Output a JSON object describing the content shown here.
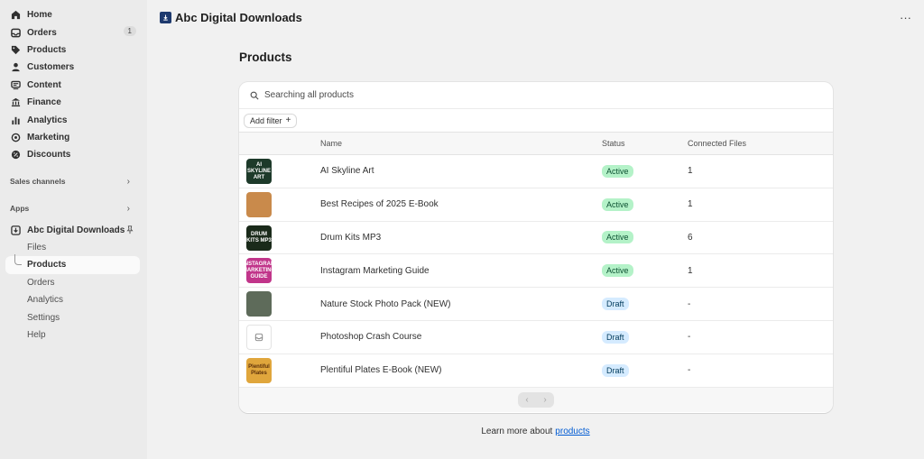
{
  "sidebar": {
    "nav": [
      {
        "label": "Home",
        "icon": "home-icon"
      },
      {
        "label": "Orders",
        "icon": "orders-icon",
        "count": "1"
      },
      {
        "label": "Products",
        "icon": "tag-icon"
      },
      {
        "label": "Customers",
        "icon": "person-icon"
      },
      {
        "label": "Content",
        "icon": "content-icon"
      },
      {
        "label": "Finance",
        "icon": "bank-icon"
      },
      {
        "label": "Analytics",
        "icon": "bar-chart-icon"
      },
      {
        "label": "Marketing",
        "icon": "target-icon"
      },
      {
        "label": "Discounts",
        "icon": "discount-icon"
      }
    ],
    "sales_channels_label": "Sales channels",
    "apps_label": "Apps",
    "app_name": "Abc Digital Downloads",
    "app_subitems": [
      "Files",
      "Products",
      "Orders",
      "Analytics",
      "Settings",
      "Help"
    ],
    "active_subitem": "Products"
  },
  "topbar": {
    "title": "Abc Digital Downloads",
    "more_label": "···"
  },
  "main": {
    "page_title": "Products",
    "search_text": "Searching all products",
    "add_filter_label": "Add filter",
    "add_filter_plus": "+",
    "columns": {
      "name": "Name",
      "status": "Status",
      "files": "Connected Files"
    },
    "rows": [
      {
        "name": "AI Skyline Art",
        "status": "Active",
        "files": "1",
        "thumb_text": "AI SKYLINE ART",
        "thumb_color": "#1d3a2a"
      },
      {
        "name": "Best Recipes of 2025 E-Book",
        "status": "Active",
        "files": "1",
        "thumb_text": "",
        "thumb_color": "#c98a4b"
      },
      {
        "name": "Drum Kits MP3",
        "status": "Active",
        "files": "6",
        "thumb_text": "DRUM KITS MP3",
        "thumb_color": "#1a2a1a"
      },
      {
        "name": "Instagram Marketing Guide",
        "status": "Active",
        "files": "1",
        "thumb_text": "INSTAGRAM MARKETING GUIDE",
        "thumb_color": "#c1358a"
      },
      {
        "name": "Nature Stock Photo Pack (NEW)",
        "status": "Draft",
        "files": "-",
        "thumb_text": "",
        "thumb_color": "#5e6b5a"
      },
      {
        "name": "Photoshop Crash Course",
        "status": "Draft",
        "files": "-",
        "thumb_text": "",
        "thumb_color": "#ffffff"
      },
      {
        "name": "Plentiful Plates E-Book (NEW)",
        "status": "Draft",
        "files": "-",
        "thumb_text": "Plentiful Plates",
        "thumb_color": "#e0a63c"
      }
    ],
    "pager_prev": "‹",
    "pager_next": "›",
    "learn_more_prefix": "Learn more about",
    "learn_more_link": "products"
  },
  "colors": {
    "active_bg": "#b4f2c8",
    "draft_bg": "#d5ebff",
    "link": "#005bd3"
  }
}
